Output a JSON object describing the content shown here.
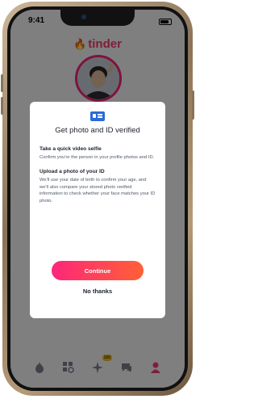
{
  "status_bar": {
    "time": "9:41"
  },
  "app": {
    "logo_text": "tinder"
  },
  "tabbar": {
    "badge": "100"
  },
  "modal": {
    "title": "Get photo and ID verified",
    "sections": [
      {
        "heading": "Take a quick video selfie",
        "body": "Confirm you're the person in your profile photos and ID."
      },
      {
        "heading": "Upload a photo of your ID",
        "body": "We'll use your date of birth to confirm your age, and we'll also compare your stored photo verified information to check whether your face matches your ID photo."
      }
    ],
    "primary_button": "Continue",
    "secondary_button": "No thanks"
  },
  "colors": {
    "brand": "#fe3c72",
    "button_gradient_start": "#fd267a",
    "button_gradient_end": "#ff6036",
    "verify_icon": "#2b6ad8"
  }
}
